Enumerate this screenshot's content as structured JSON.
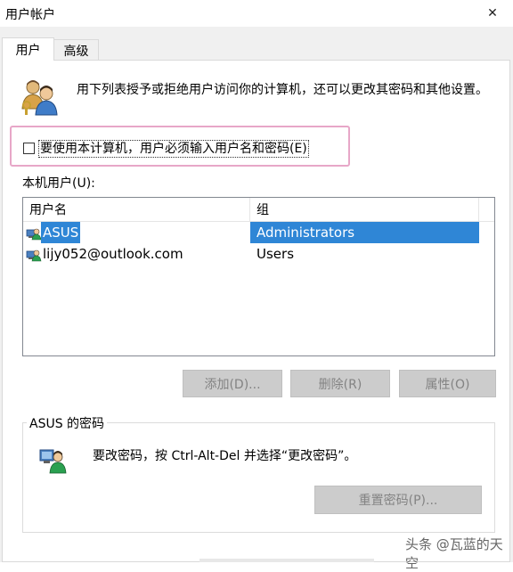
{
  "window": {
    "title": "用户帐户",
    "close_symbol": "✕"
  },
  "tabs": [
    {
      "label": "用户",
      "active": true
    },
    {
      "label": "高级",
      "active": false
    }
  ],
  "description": "用下列表授予或拒绝用户访问你的计算机，还可以更改其密码和其他设置。",
  "require_password": {
    "label": "要使用本计算机，用户必须输入用户名和密码(E)",
    "checked": false
  },
  "users_section": {
    "label": "本机用户(U):",
    "columns": [
      "用户名",
      "组"
    ],
    "rows": [
      {
        "name": "ASUS",
        "group": "Administrators",
        "selected": true
      },
      {
        "name": "lijy052@outlook.com",
        "group": "Users",
        "selected": false
      }
    ]
  },
  "buttons": {
    "add": "添加(D)...",
    "remove": "删除(R)",
    "properties": "属性(O)",
    "reset_password": "重置密码(P)..."
  },
  "password_group": {
    "title": "ASUS 的密码",
    "text": "要改密码，按 Ctrl-Alt-Del 并选择“更改密码”。"
  },
  "watermark": "头条 @瓦蓝的天空",
  "colors": {
    "selection": "#2f86d6",
    "highlight_border": "#e7a7c8",
    "disabled_button": "#cccccc"
  }
}
